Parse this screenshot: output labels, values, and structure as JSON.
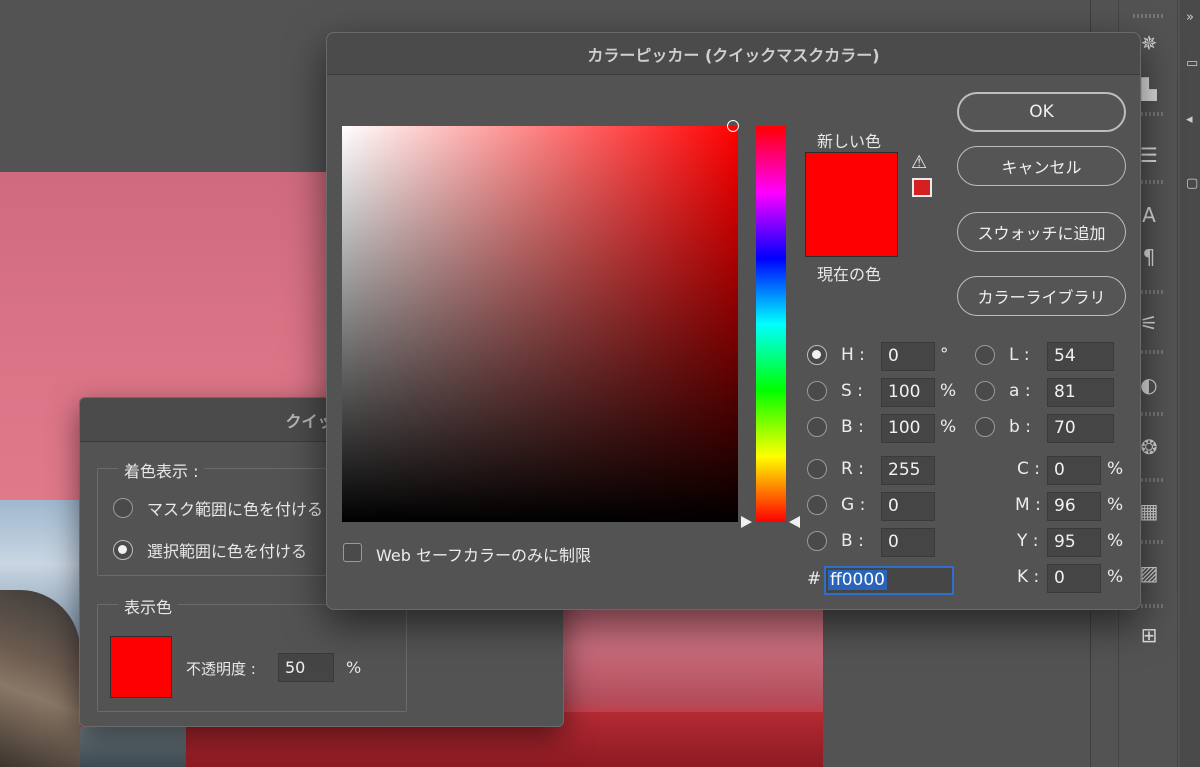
{
  "color_picker": {
    "title": "カラーピッカー (クイックマスクカラー)",
    "new_label": "新しい色",
    "current_label": "現在の色",
    "new_color": "#ff0000",
    "current_color": "#ff0000",
    "buttons": {
      "ok": "OK",
      "cancel": "キャンセル",
      "add_to_swatches": "スウォッチに追加",
      "color_libraries": "カラーライブラリ"
    },
    "hsb": {
      "h": {
        "label": "H :",
        "value": "0",
        "unit": "°",
        "selected": true
      },
      "s": {
        "label": "S :",
        "value": "100",
        "unit": "%",
        "selected": false
      },
      "b": {
        "label": "B :",
        "value": "100",
        "unit": "%",
        "selected": false
      }
    },
    "rgb": {
      "r": {
        "label": "R :",
        "value": "255"
      },
      "g": {
        "label": "G :",
        "value": "0"
      },
      "b": {
        "label": "B :",
        "value": "0"
      }
    },
    "lab": {
      "l": {
        "label": "L :",
        "value": "54"
      },
      "a": {
        "label": "a :",
        "value": "81"
      },
      "b": {
        "label": "b :",
        "value": "70"
      }
    },
    "cmyk": {
      "c": {
        "label": "C :",
        "value": "0",
        "unit": "%"
      },
      "m": {
        "label": "M :",
        "value": "96",
        "unit": "%"
      },
      "y": {
        "label": "Y :",
        "value": "95",
        "unit": "%"
      },
      "k": {
        "label": "K :",
        "value": "0",
        "unit": "%"
      }
    },
    "hex_prefix": "#",
    "hex_value": "ff0000",
    "web_safe_label": "Web セーフカラーのみに制限",
    "web_safe_checked": false
  },
  "quick_mask": {
    "title": "クイックマスク",
    "color_indicates_legend": "着色表示 :",
    "options": [
      {
        "label": "マスク範囲に色を付ける",
        "selected": false
      },
      {
        "label": "選択範囲に色を付ける",
        "selected": true
      }
    ],
    "color_legend": "表示色",
    "color": "#ff0000",
    "opacity_label": "不透明度 :",
    "opacity_value": "50",
    "opacity_unit": "%"
  },
  "dock": {
    "icons": [
      "compass-icon",
      "histogram-icon",
      "brush-settings-icon",
      "character-icon",
      "paragraph-icon",
      "adjustments-icon",
      "styles-icon",
      "color-palette-icon",
      "grid-icon",
      "gradient-icon",
      "swatches-icon"
    ]
  }
}
